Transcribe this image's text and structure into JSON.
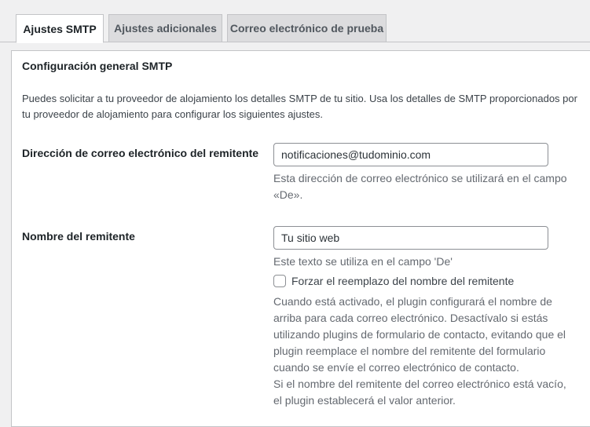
{
  "tabs": [
    {
      "label": "Ajustes SMTP",
      "active": true
    },
    {
      "label": "Ajustes adicionales",
      "active": false
    },
    {
      "label": "Correo electrónico de prueba",
      "active": false
    }
  ],
  "section": {
    "title": "Configuración general SMTP",
    "description": "Puedes solicitar a tu proveedor de alojamiento los detalles SMTP de tu sitio. Usa los detalles de SMTP proporcionados por tu proveedor de alojamiento para configurar los siguientes ajustes."
  },
  "from_email": {
    "label": "Dirección de correo electrónico del remitente",
    "value": "notificaciones@tudominio.com",
    "help": "Esta dirección de correo electrónico se utilizará en el campo «De»."
  },
  "from_name": {
    "label": "Nombre del remitente",
    "value": "Tu sitio web",
    "help": "Este texto se utiliza en el campo 'De'",
    "force_checkbox": {
      "label": "Forzar el reemplazo del nombre del remitente",
      "checked": false
    },
    "force_help_1": "Cuando está activado, el plugin configurará el nombre de arriba para cada correo electrónico. Desactívalo si estás utilizando plugins de formulario de contacto, evitando que el plugin reemplace el nombre del remitente del formulario cuando se envíe el correo electrónico de contacto.",
    "force_help_2": "Si el nombre del remitente del correo electrónico está vacío, el plugin establecerá el valor anterior."
  }
}
